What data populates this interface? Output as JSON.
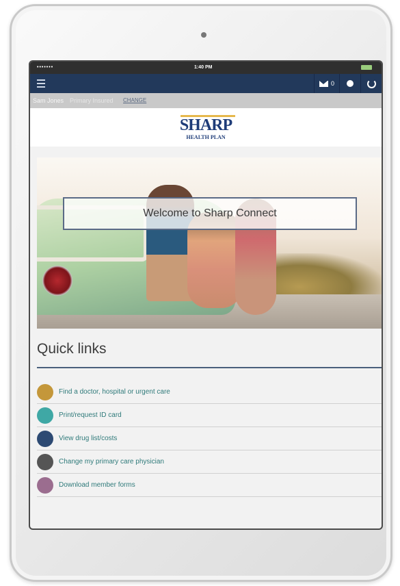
{
  "status_bar": {
    "signal": "•••••••",
    "time": "1:40 PM"
  },
  "nav": {
    "mail_count": "0"
  },
  "user": {
    "name": "Sam Jones",
    "role": "Primary Insured",
    "change_label": "CHANGE"
  },
  "logo": {
    "line1": "SHARP",
    "line2": "HEALTH PLAN"
  },
  "hero": {
    "welcome_text": "Welcome to Sharp Connect"
  },
  "quick_links": {
    "title": "Quick links",
    "items": [
      {
        "label": "Find a doctor, hospital or urgent care",
        "color": "#c4973a"
      },
      {
        "label": "Print/request ID card",
        "color": "#3fa8a5"
      },
      {
        "label": "View drug list/costs",
        "color": "#2d4a73"
      },
      {
        "label": "Change my primary care physician",
        "color": "#555555"
      },
      {
        "label": "Download member forms",
        "color": "#9b6d8f"
      }
    ]
  },
  "colors": {
    "nav_bg": "#22395b",
    "accent_gold": "#e6b84c",
    "link_teal": "#2f7a7a"
  }
}
